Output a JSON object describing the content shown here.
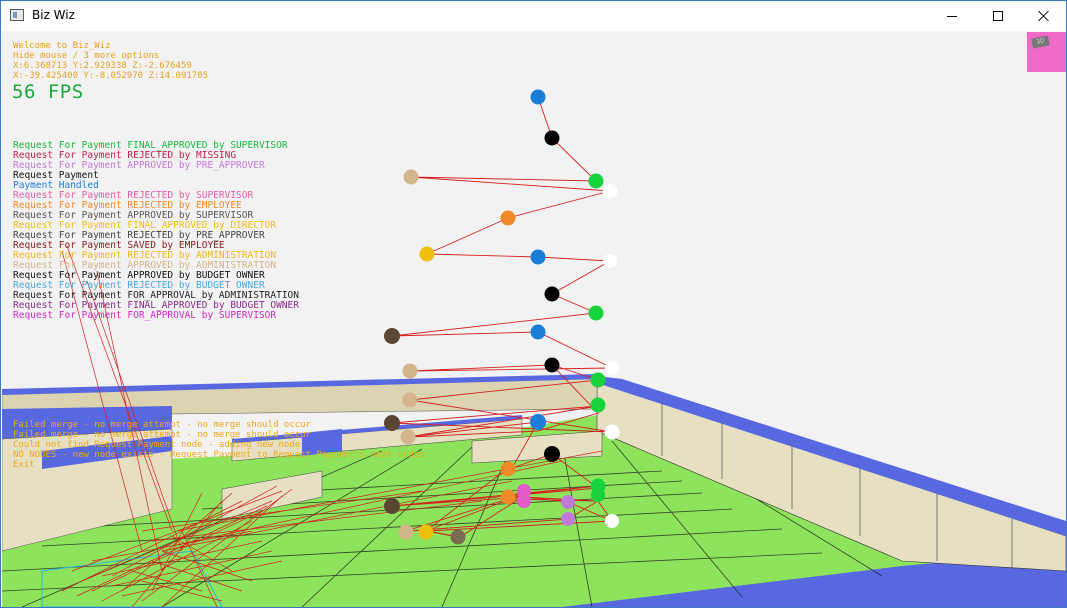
{
  "window": {
    "title": "Biz Wiz"
  },
  "hud": {
    "welcome": "Welcome to Biz_Wiz",
    "hint": "Hide mouse / 3 more options",
    "coords1": "X:6.368713 Y:2.929338 Z:-2.676459",
    "coords2": "X:-39.425400 Y:-8.052970 Z:14.091705",
    "fps": "56 FPS"
  },
  "legend": [
    {
      "text": "Request For Payment FINAL_APPROVED by SUPERVISOR",
      "color": "#f4f4f4"
    },
    {
      "text": "Request For Payment FINAL_APPROVED by SUPERVISOR",
      "color": "#17b83c"
    },
    {
      "text": "Request For Payment REJECTED by MISSING",
      "color": "#c81e4a"
    },
    {
      "text": "Request For Payment APPROVED by PRE_APPROVER",
      "color": "#c27ad8"
    },
    {
      "text": "Request Payment",
      "color": "#111111"
    },
    {
      "text": "Payment Handled",
      "color": "#1a7ed8"
    },
    {
      "text": "Request For Payment REJECTED by SUPERVISOR",
      "color": "#e65aa8"
    },
    {
      "text": "Request For Payment REJECTED by EMPLOYEE",
      "color": "#f08a28"
    },
    {
      "text": "Request For Payment APPROVED by SUPERVISOR",
      "color": "#555555"
    },
    {
      "text": "Request For Payment FINAL_APPROVED by DIRECTOR",
      "color": "#f0c010"
    },
    {
      "text": "Request For Payment REJECTED by PRE_APPROVER",
      "color": "#444444"
    },
    {
      "text": "Request For Payment SAVED by EMPLOYEE",
      "color": "#8a1a1a"
    },
    {
      "text": "Request For Payment REJECTED by ADMINISTRATION",
      "color": "#f0b818"
    },
    {
      "text": "Request For Payment APPROVED by ADMINISTRATION",
      "color": "#d4b48a"
    },
    {
      "text": "Request For Payment APPROVED by BUDGET OWNER",
      "color": "#111111"
    },
    {
      "text": "Request For Payment REJECTED by BUDGET OWNER",
      "color": "#4aa8e0"
    },
    {
      "text": "Request For Payment FOR_APPROVAL by ADMINISTRATION",
      "color": "#222222"
    },
    {
      "text": "Request For Payment FINAL_APPROVED by BUDGET OWNER",
      "color": "#8a2a8a"
    },
    {
      "text": "Request For Payment FOR_APPROVAL by SUPERVISOR",
      "color": "#d028c8"
    }
  ],
  "log": [
    "Failed merge - no merge attempt - no merge should occur",
    "Failed merge - no merge attempt - no merge should occur",
    "Could not find Request Payment node - adding new node",
    "NO NODES - new node exists - Request Payment to Request Payment's next nodes",
    "Exit"
  ],
  "minimap": {
    "label": "3D"
  },
  "colors": {
    "floor": "#8ee35c",
    "wall_top": "#5868e0",
    "wall_face": "#e8e2c8",
    "edge": "#d42020"
  }
}
